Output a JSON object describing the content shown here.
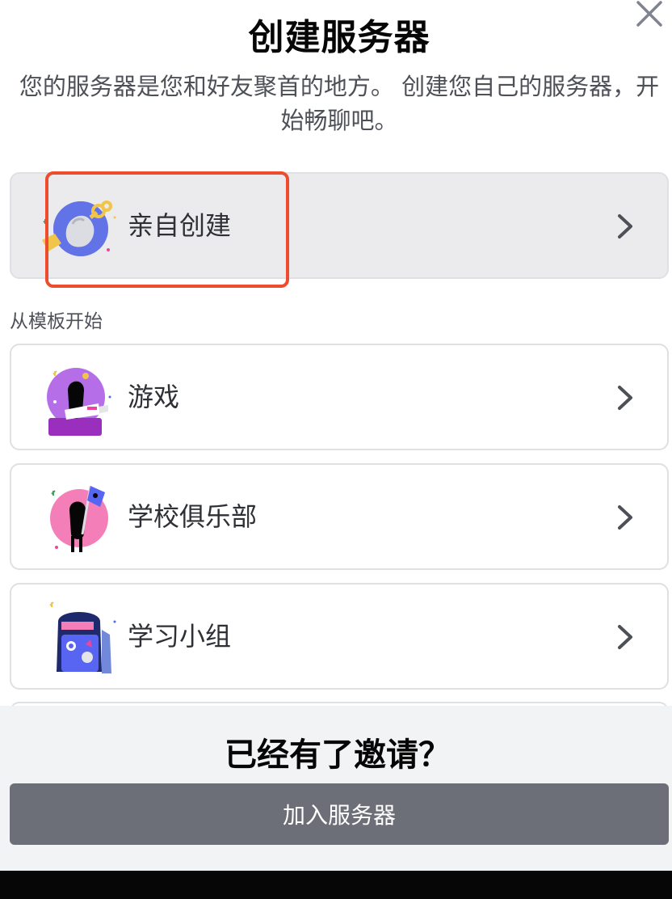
{
  "dialog": {
    "title": "创建服务器",
    "subtitle": "您的服务器是您和好友聚首的地方。 创建您自己的服务器，开始畅聊吧。"
  },
  "create_own": {
    "label": "亲自创建",
    "icon": "create-own-icon"
  },
  "templates": {
    "section_label": "从模板开始",
    "items": [
      {
        "label": "游戏",
        "icon": "gaming-icon"
      },
      {
        "label": "学校俱乐部",
        "icon": "school-club-icon"
      },
      {
        "label": "学习小组",
        "icon": "study-group-icon"
      }
    ]
  },
  "footer": {
    "title": "已经有了邀请？",
    "join_label": "加入服务器"
  },
  "colors": {
    "highlight": "#ee4d2d",
    "join_button": "#6d6f78",
    "footer_bg": "#f2f3f5"
  }
}
